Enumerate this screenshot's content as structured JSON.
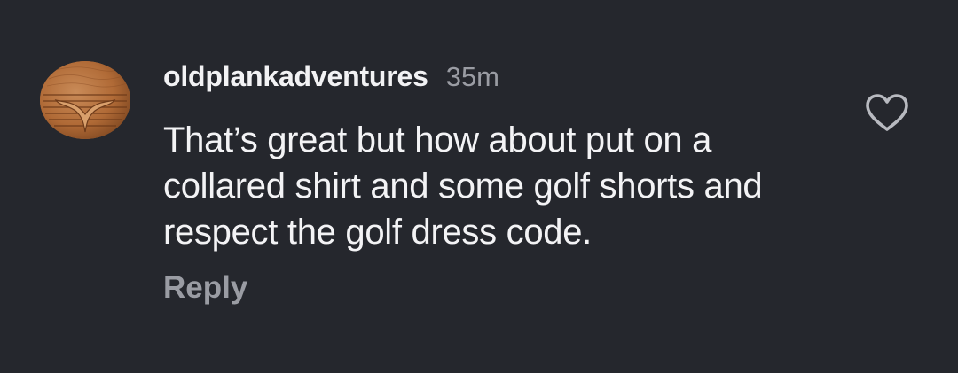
{
  "comment": {
    "username": "oldplankadventures",
    "timestamp": "35m",
    "text": "That’s great but how about put on a collared shirt and some golf shorts and respect the golf dress code.",
    "reply_label": "Reply",
    "avatar_icon": "whale-tail-wood-logo",
    "like_icon": "heart-outline-icon"
  },
  "colors": {
    "background": "#25272d",
    "primary_text": "#f2f2f4",
    "secondary_text": "#9a9ca3",
    "avatar_wood": "#b06a36"
  }
}
